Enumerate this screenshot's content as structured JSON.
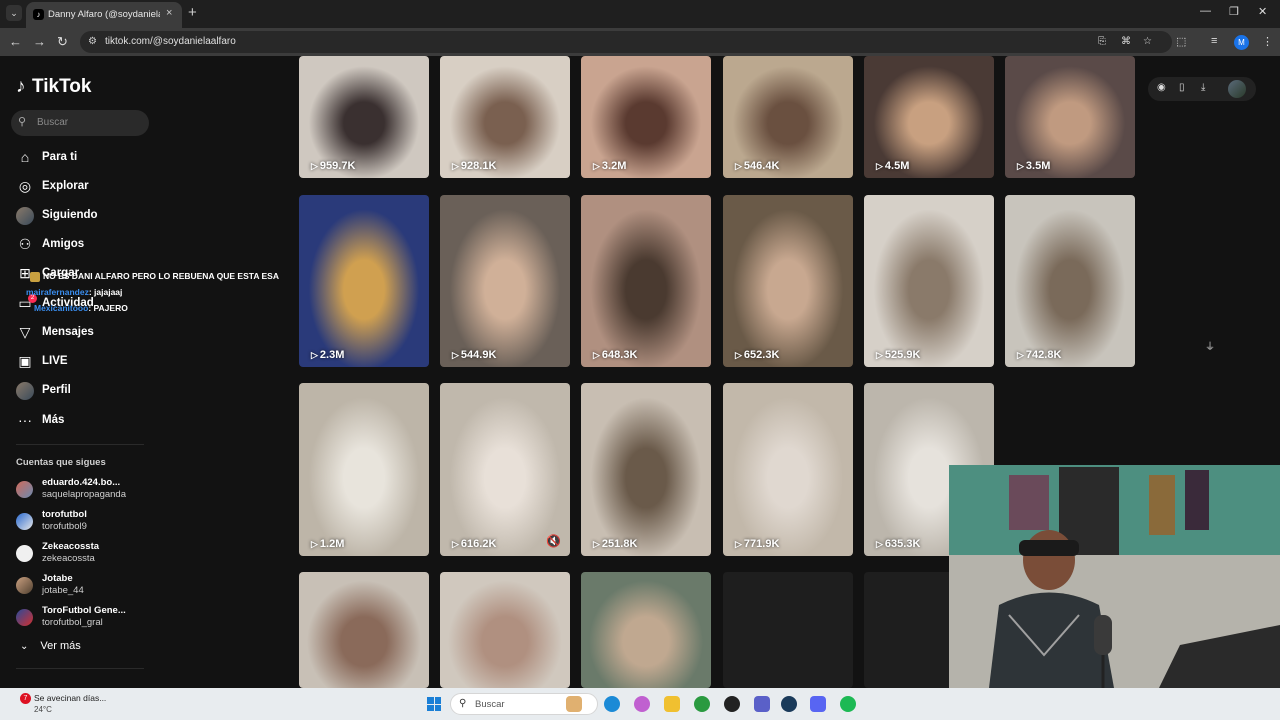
{
  "browser": {
    "tab_title": "Danny Alfaro (@soydanielaalfar",
    "tab_close": "×",
    "new_tab": "+",
    "url": "tiktok.com/@soydanielaalfaro",
    "profile_initial": "M"
  },
  "sidebar": {
    "logo": "TikTok",
    "search_placeholder": "Buscar",
    "nav": [
      {
        "label": "Para ti",
        "icon": "home-icon"
      },
      {
        "label": "Explorar",
        "icon": "compass-icon"
      },
      {
        "label": "Siguiendo",
        "icon": "following-avatar-icon"
      },
      {
        "label": "Amigos",
        "icon": "friends-icon"
      },
      {
        "label": "Cargar",
        "icon": "upload-icon"
      },
      {
        "label": "Actividad",
        "icon": "inbox-icon"
      },
      {
        "label": "Mensajes",
        "icon": "messages-icon"
      },
      {
        "label": "LIVE",
        "icon": "live-icon"
      },
      {
        "label": "Perfil",
        "icon": "profile-avatar-icon"
      },
      {
        "label": "Más",
        "icon": "more-icon"
      }
    ],
    "activity_badge": "2",
    "following_title": "Cuentas que sigues",
    "following": [
      {
        "name": "eduardo.424.bo...",
        "username": "saquelapropaganda"
      },
      {
        "name": "torofutbol",
        "username": "torofutbol9"
      },
      {
        "name": "Zekeacossta",
        "username": "zekeacossta"
      },
      {
        "name": "Jotabe",
        "username": "jotabe_44"
      },
      {
        "name": "ToroFutbol Gene...",
        "username": "torofutbol_gral"
      }
    ],
    "see_more": "Ver más"
  },
  "stream_overlay": {
    "title": "NO ES DANI ALFARO PERO LO REBUENA QUE ESTA ESA",
    "chat": [
      {
        "user": "mairafernandez",
        "message": ": jajajaaj"
      },
      {
        "user": "Mexicanitooo",
        "message": ": PAJERO"
      }
    ]
  },
  "videos": [
    {
      "views": "959.7K"
    },
    {
      "views": "928.1K"
    },
    {
      "views": "3.2M"
    },
    {
      "views": "546.4K"
    },
    {
      "views": "4.5M"
    },
    {
      "views": "3.5M"
    },
    {
      "views": "2.3M"
    },
    {
      "views": "544.9K"
    },
    {
      "views": "648.3K"
    },
    {
      "views": "652.3K"
    },
    {
      "views": "525.9K"
    },
    {
      "views": "742.8K"
    },
    {
      "views": "1.2M"
    },
    {
      "views": "616.2K"
    },
    {
      "views": "251.8K"
    },
    {
      "views": "771.9K"
    },
    {
      "views": "635.3K"
    }
  ],
  "taskbar": {
    "weather_text": "Se avecinan días...",
    "weather_temp": "24°C",
    "search_placeholder": "Buscar",
    "weather_badge": "7"
  }
}
